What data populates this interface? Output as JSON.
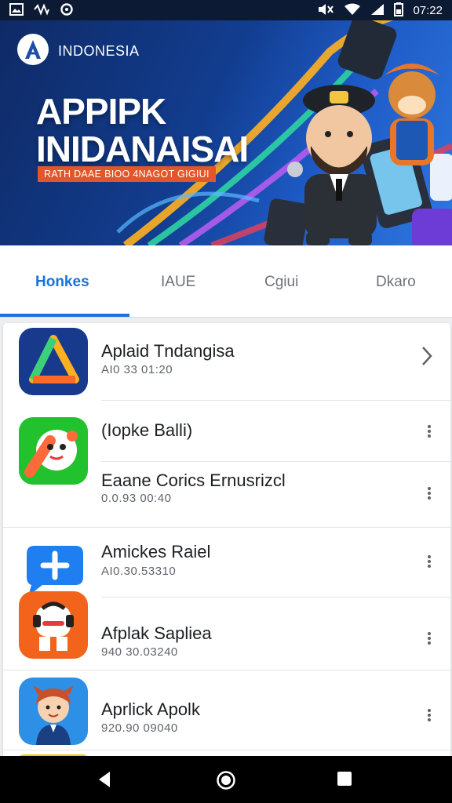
{
  "status_bar": {
    "left_icons": [
      "gallery-icon",
      "network-activity-icon",
      "sync-icon"
    ],
    "right_icons": [
      "mute-icon",
      "wifi-icon",
      "signal-icon",
      "battery-icon"
    ],
    "time": "07:22"
  },
  "banner": {
    "brand": "INDONESIA",
    "headline_line1": "APPIPK",
    "headline_line2": "INIDANAISAI",
    "ribbon": "RATH DAAE BIOO 4NAGOT GIGIUI"
  },
  "tabs": [
    {
      "label": "Honkes",
      "active": true
    },
    {
      "label": "IAUE",
      "active": false
    },
    {
      "label": "Cgiui",
      "active": false
    },
    {
      "label": "Dkaro",
      "active": false
    }
  ],
  "apps": [
    {
      "name": "Aplaid Tndangisa",
      "meta": "AI0 33 01:20",
      "action": "chevron"
    },
    {
      "name": "(Iopke Balli)",
      "meta": "",
      "action": "more"
    },
    {
      "name": "Eaane Corics Ernusrizcl",
      "meta": "0.0.93 00:40",
      "action": "more"
    },
    {
      "name": "Amickes Raiel",
      "meta": "AI0.30.53310",
      "action": "more"
    },
    {
      "name": "Afplak Sapliea",
      "meta": "940 30.03240",
      "action": "more"
    },
    {
      "name": "Aprlick Apolk",
      "meta": "920.90 09040",
      "action": "more"
    }
  ],
  "colors": {
    "accent": "#1a73d9",
    "status_bar": "#0d1a33",
    "ribbon": "#e2562a"
  }
}
